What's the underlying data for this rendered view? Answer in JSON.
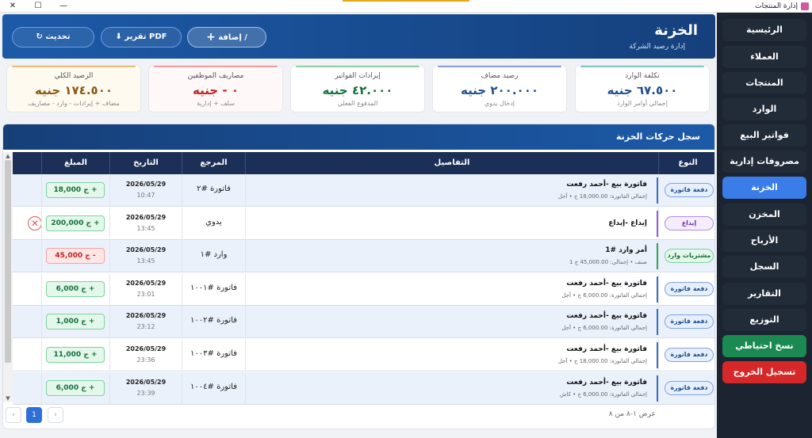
{
  "window": {
    "title": "إدارة المنتجات",
    "controls": {
      "close": "✕",
      "maximize": "☐",
      "minimize": "—"
    }
  },
  "sidebar": {
    "items": [
      {
        "label": "الرئيسية"
      },
      {
        "label": "العملاء"
      },
      {
        "label": "المنتجات"
      },
      {
        "label": "الوارد"
      },
      {
        "label": "فواتير البيع"
      },
      {
        "label": "مصروفات إدارية"
      },
      {
        "label": "الخزنة",
        "active": true
      },
      {
        "label": "المخزن"
      },
      {
        "label": "الأرباح"
      },
      {
        "label": "السجل"
      },
      {
        "label": "التقارير"
      },
      {
        "label": "التوزيع"
      }
    ],
    "backup_label": "نسخ احتياطي",
    "logout_label": "تسجيل الخروج",
    "colors": {
      "active": "#3a7ce8",
      "backup": "#1a8a52",
      "logout": "#d62828"
    }
  },
  "header": {
    "title": "الخزنة",
    "subtitle": "إدارة رصيد الشركة",
    "add_label": "إضافة /",
    "add_icon": "plus-icon",
    "pdf_label": "تقرير PDF",
    "pdf_icon": "download-icon",
    "refresh_label": "تحديث",
    "refresh_icon": "refresh-icon"
  },
  "stats": [
    {
      "label": "تكلفة الوارد",
      "value": "٦٧.٥٠٠ جنيه",
      "sub": "إجمالي أوامر الوارد",
      "color": "#1f4f8a",
      "bar": "#7ec8c2"
    },
    {
      "label": "رصيد مضاف",
      "value": "٢٠٠.٠٠٠ جنيه",
      "sub": "إدخال يدوي",
      "color": "#1f4f8a",
      "bar": "#8a9fd8"
    },
    {
      "label": "إيرادات الفواتير",
      "value": "٤٢.٠٠٠ جنيه",
      "sub": "المدفوع الفعلي",
      "color": "#15703c",
      "bar": "#8ed0a6"
    },
    {
      "label": "مصاريف الموظفين",
      "value": "٠ - جنيه",
      "sub": "سلف + إدارية",
      "color": "#c42121",
      "bar": "#f0a0a0"
    },
    {
      "label": "الرصيد الكلي",
      "value": "١٧٤.٥٠٠ جنيه",
      "sub": "مضاف + إيرادات - وارد - مصاريف",
      "color": "#8a5a12",
      "bar": "#e6c07a"
    }
  ],
  "ledger": {
    "title": "سجل حركات الخزنة",
    "columns": {
      "type": "النوع",
      "details": "التفاصيل",
      "reference": "المرجع",
      "date": "التاريخ",
      "amount": "المبلغ"
    },
    "rows": [
      {
        "type": "دفعة فاتورة",
        "type_style": "invoice",
        "title": "فاتورة بيع -أحمد رفعت",
        "detail": "إجمالي الفاتورة: 18,000.00 ج • آجل",
        "reference": "فاتورة #٢",
        "date": "2026/05/29",
        "time": "10:47",
        "amount": "ج 18,000 +",
        "sign": "pos",
        "deletable": false
      },
      {
        "type": "إيداع",
        "type_style": "deposit",
        "title": "إيداع -إيداع",
        "detail": "",
        "reference": "يدوي",
        "date": "2026/05/29",
        "time": "13:45",
        "amount": "ج 200,000 +",
        "sign": "pos",
        "deletable": true,
        "delete_icon": "✕"
      },
      {
        "type": "مشتريات وارد",
        "type_style": "purchase",
        "title": "أمر وارد #1",
        "detail": "صنف • إجمالي: 45,000.00 ج 1",
        "reference": "وارد #١",
        "date": "2026/05/29",
        "time": "13:45",
        "amount": "ج 45,000 -",
        "sign": "neg",
        "deletable": false
      },
      {
        "type": "دفعة فاتورة",
        "type_style": "invoice",
        "title": "فاتورة بيع -أحمد رفعت",
        "detail": "إجمالي الفاتورة: 6,000.00 ج • آجل",
        "reference": "فاتورة #١٠٠١",
        "date": "2026/05/29",
        "time": "23:01",
        "amount": "ج 6,000 +",
        "sign": "pos",
        "deletable": false
      },
      {
        "type": "دفعة فاتورة",
        "type_style": "invoice",
        "title": "فاتورة بيع -أحمد رفعت",
        "detail": "إجمالي الفاتورة: 6,000.00 ج • آجل",
        "reference": "فاتورة #١٠٠٢",
        "date": "2026/05/29",
        "time": "23:12",
        "amount": "ج 1,000 +",
        "sign": "pos",
        "deletable": false
      },
      {
        "type": "دفعة فاتورة",
        "type_style": "invoice",
        "title": "فاتورة بيع -أحمد رفعت",
        "detail": "إجمالي الفاتورة: 18,000.00 ج • آجل",
        "reference": "فاتورة #١٠٠٣",
        "date": "2026/05/29",
        "time": "23:36",
        "amount": "ج 11,000 +",
        "sign": "pos",
        "deletable": false
      },
      {
        "type": "دفعة فاتورة",
        "type_style": "invoice",
        "title": "فاتورة بيع -أحمد رفعت",
        "detail": "إجمالي الفاتورة: 6,000.00 ج • كاش",
        "reference": "فاتورة #١٠٠٤",
        "date": "2026/05/29",
        "time": "23:39",
        "amount": "ج 6,000 +",
        "sign": "pos",
        "deletable": false
      }
    ],
    "type_styles": {
      "invoice": {
        "bg": "#e6efff",
        "border": "#7fa2e0",
        "text": "#1f4f8a",
        "bar": "#3a6fc2"
      },
      "deposit": {
        "bg": "#f5ecfd",
        "border": "#b48ce0",
        "text": "#6b2fa8",
        "bar": "#9a5cd8"
      },
      "purchase": {
        "bg": "#e3f7ea",
        "border": "#7fd3a0",
        "text": "#15703c",
        "bar": "#2fa35f"
      }
    }
  },
  "pagination": {
    "info": "عرض ١-٨ من ٨",
    "current": "1",
    "prev": "‹",
    "next": "›"
  }
}
